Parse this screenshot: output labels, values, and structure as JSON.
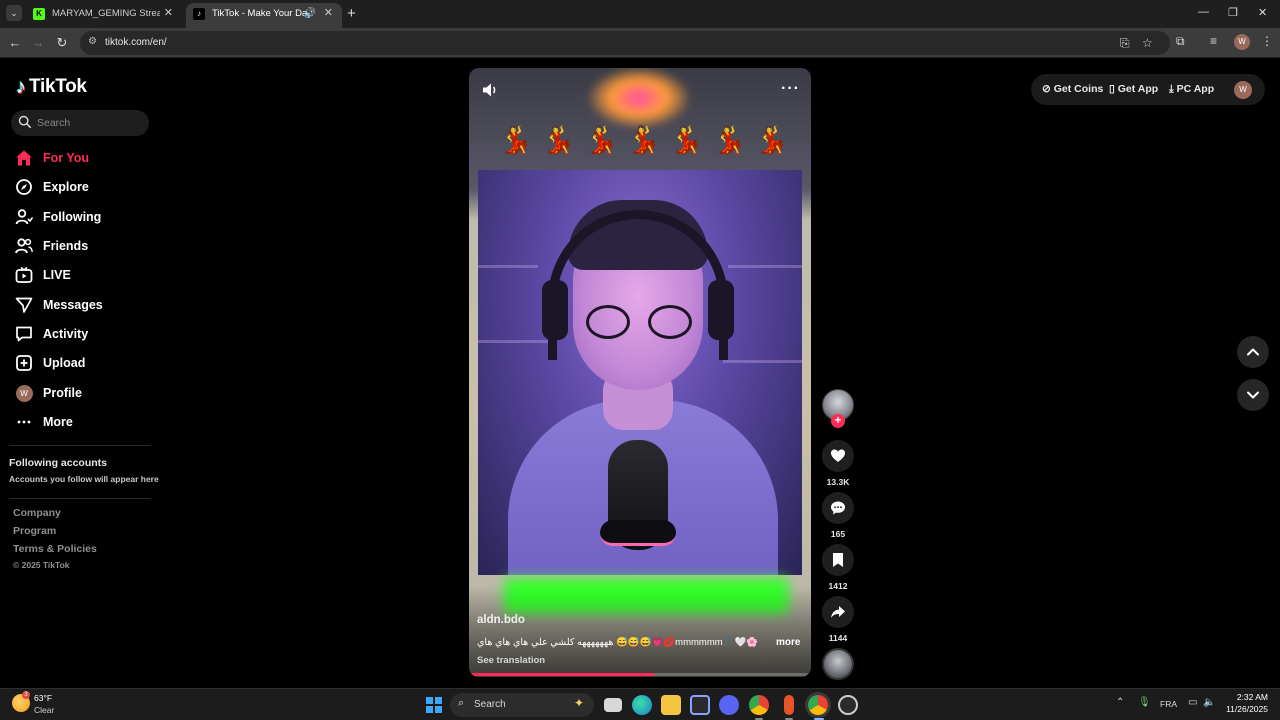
{
  "browser": {
    "tabs": [
      {
        "title": "MARYAM_GEMING Stream - Ki",
        "active": false,
        "favicon": "kick-icon"
      },
      {
        "title": "TikTok - Make Your Day",
        "active": true,
        "favicon": "tiktok-icon",
        "audio": true
      }
    ],
    "url": "tiktok.com/en/",
    "profile_initial": "W"
  },
  "tiktok": {
    "logo_text": "TikTok",
    "search_placeholder": "Search",
    "nav": [
      {
        "label": "For You",
        "icon": "home-icon",
        "active": true
      },
      {
        "label": "Explore",
        "icon": "compass-icon",
        "active": false
      },
      {
        "label": "Following",
        "icon": "following-icon",
        "active": false
      },
      {
        "label": "Friends",
        "icon": "friends-icon",
        "active": false
      },
      {
        "label": "LIVE",
        "icon": "live-icon",
        "active": false
      },
      {
        "label": "Messages",
        "icon": "messages-icon",
        "active": false
      },
      {
        "label": "Activity",
        "icon": "activity-icon",
        "active": false
      },
      {
        "label": "Upload",
        "icon": "upload-icon",
        "active": false
      },
      {
        "label": "Profile",
        "icon": "avatar",
        "active": false
      },
      {
        "label": "More",
        "icon": "more-dots-icon",
        "active": false
      }
    ],
    "profile_initial": "W",
    "following_accounts_title": "Following accounts",
    "following_accounts_sub": "Accounts you follow will appear here",
    "footer": [
      "Company",
      "Program",
      "Terms & Policies"
    ],
    "copyright": "© 2025 TikTok",
    "top_actions": {
      "coins": "Get Coins",
      "app": "Get App",
      "pc": "PC App",
      "avatar_initial": "W"
    },
    "accent": "#fe2c55"
  },
  "video": {
    "overlay_emoji": "💃",
    "author": "aldn.bdo",
    "caption": "هههههههه كلشي علي هاي هاي هاي 😅😅😅💗💋mmmmmm🎵🤍🌸",
    "more_label": "more",
    "see_translation": "See translation",
    "progress": 0.54,
    "likes": "13.3K",
    "comments": "165",
    "saves": "1412",
    "shares": "1144"
  },
  "taskbar": {
    "temperature": "63°F",
    "weather": "Clear",
    "weather_badge": "3",
    "search_label": "Search",
    "language": "FRA",
    "time": "2:32 AM",
    "date": "11/26/2025"
  }
}
